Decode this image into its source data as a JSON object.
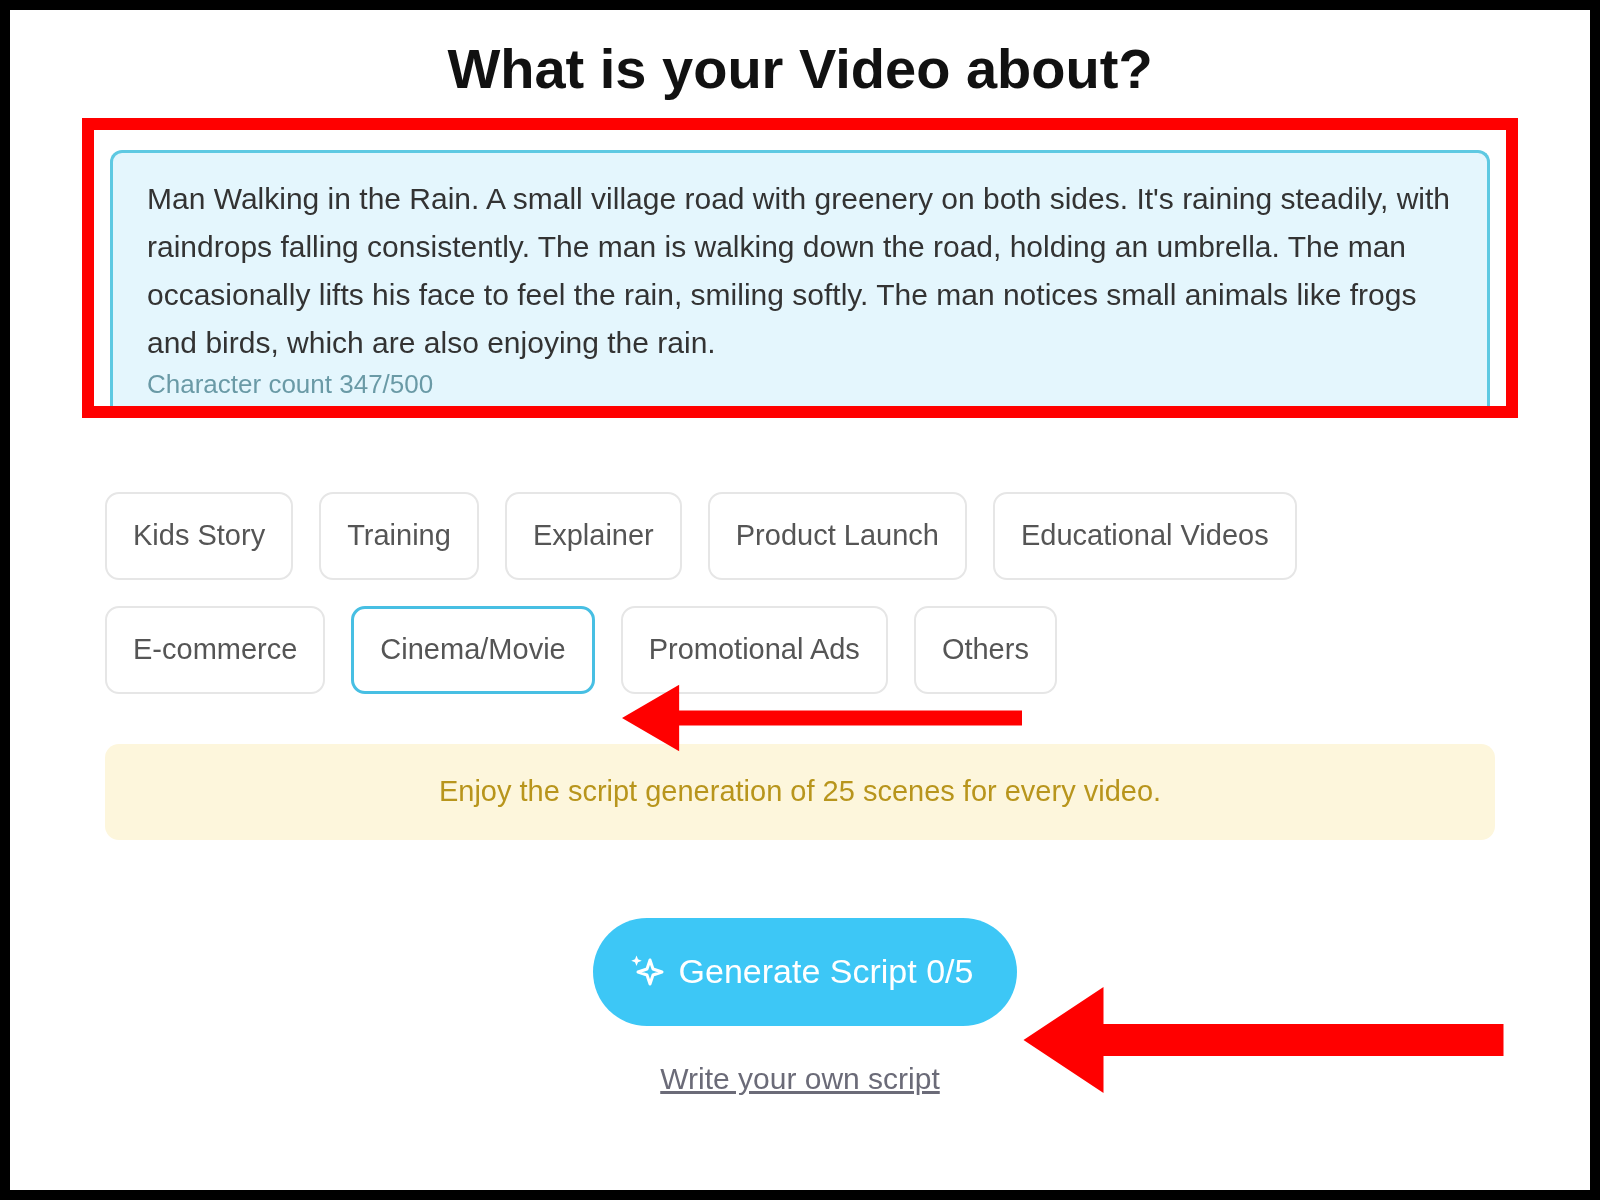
{
  "title": "What is your Video about?",
  "description": {
    "value": "Man Walking in the Rain.  A small village road with greenery on both sides.  It's raining steadily, with raindrops falling consistently. The man is walking down the road, holding an umbrella. The man occasionally lifts his face to feel the rain, smiling softly. The man notices small animals like frogs and birds, which are also enjoying the rain.",
    "character_count": "Character count 347/500"
  },
  "categories": [
    [
      {
        "label": "Kids Story",
        "selected": false
      },
      {
        "label": "Training",
        "selected": false
      },
      {
        "label": "Explainer",
        "selected": false
      },
      {
        "label": "Product Launch",
        "selected": false
      },
      {
        "label": "Educational Videos",
        "selected": false
      }
    ],
    [
      {
        "label": "E-commerce",
        "selected": false
      },
      {
        "label": "Cinema/Movie",
        "selected": true
      },
      {
        "label": "Promotional Ads",
        "selected": false
      },
      {
        "label": "Others",
        "selected": false
      }
    ]
  ],
  "notice": "Enjoy the script generation of 25 scenes for every video.",
  "generate_button": "Generate Script 0/5",
  "write_link": "Write your own script"
}
